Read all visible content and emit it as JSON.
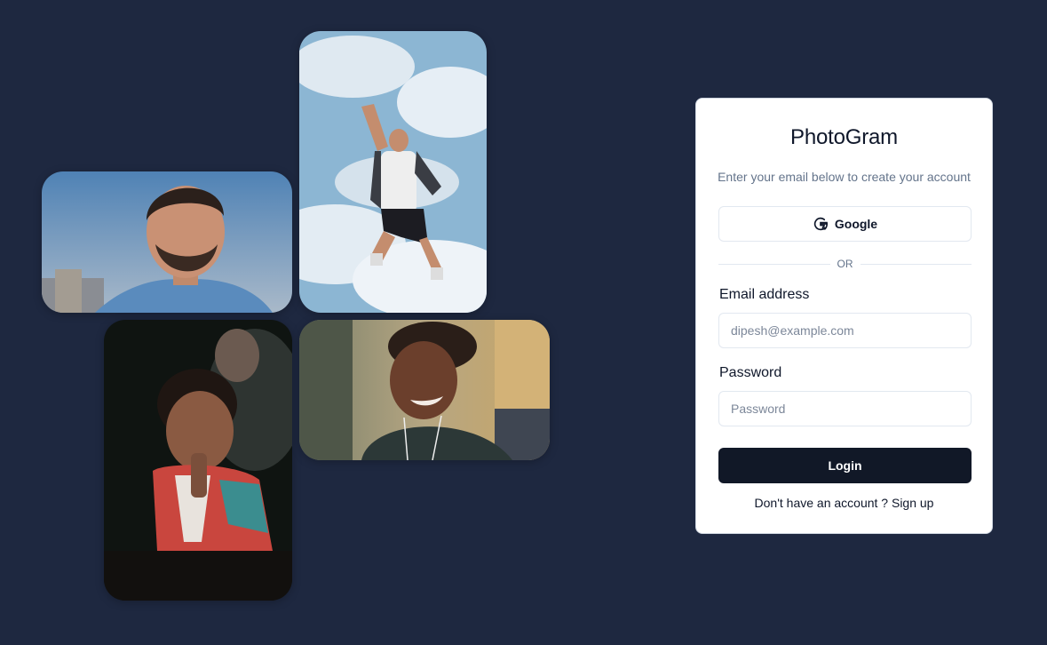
{
  "gallery": {
    "photos": [
      {
        "subject": "bearded-man-portrait"
      },
      {
        "subject": "man-jumping-sky"
      },
      {
        "subject": "child-laughing"
      },
      {
        "subject": "woman-smiling-earphones"
      }
    ]
  },
  "login": {
    "title": "PhotoGram",
    "subtitle": "Enter your email below to create your account",
    "google_label": "Google",
    "divider_text": "OR",
    "email_label": "Email address",
    "email_placeholder": "dipesh@example.com",
    "email_value": "",
    "password_label": "Password",
    "password_placeholder": "Password",
    "password_value": "",
    "login_label": "Login",
    "signup_prompt": "Don't have an account ?",
    "signup_link": "Sign up"
  },
  "colors": {
    "background": "#1e2840",
    "card": "#ffffff",
    "primary_button": "#111827"
  }
}
